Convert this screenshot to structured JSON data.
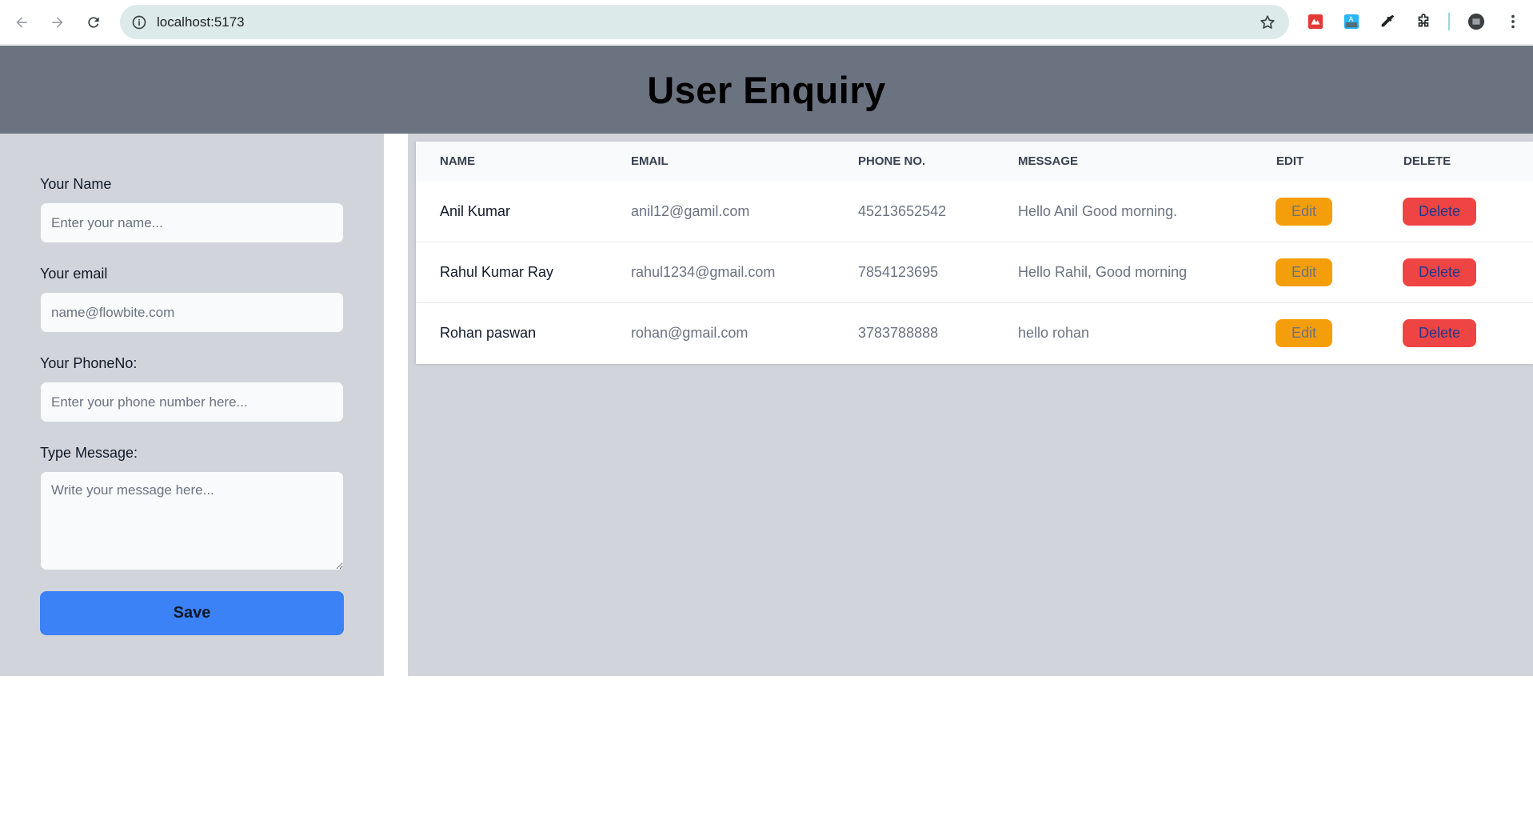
{
  "browser": {
    "url": "localhost:5173"
  },
  "header": {
    "title": "User Enquiry"
  },
  "form": {
    "name_label": "Your Name",
    "name_placeholder": "Enter your name...",
    "email_label": "Your email",
    "email_placeholder": "name@flowbite.com",
    "phone_label": "Your PhoneNo:",
    "phone_placeholder": "Enter your phone number here...",
    "message_label": "Type Message:",
    "message_placeholder": "Write your message here...",
    "save_label": "Save"
  },
  "table": {
    "columns": [
      "NAME",
      "EMAIL",
      "PHONE NO.",
      "MESSAGE",
      "EDIT",
      "DELETE"
    ],
    "rows": [
      {
        "name": "Anil Kumar",
        "email": "anil12@gamil.com",
        "phone": "45213652542",
        "message": "Hello Anil Good morning.",
        "edit": "Edit",
        "delete": "Delete"
      },
      {
        "name": "Rahul Kumar Ray",
        "email": "rahul1234@gmail.com",
        "phone": "7854123695",
        "message": "Hello Rahil, Good morning",
        "edit": "Edit",
        "delete": "Delete"
      },
      {
        "name": "Rohan paswan",
        "email": "rohan@gmail.com",
        "phone": "3783788888",
        "message": "hello rohan",
        "edit": "Edit",
        "delete": "Delete"
      }
    ]
  },
  "colors": {
    "header_bg": "#6b7280",
    "panel_bg": "#d1d5db",
    "save_bg": "#3b82f6",
    "edit_bg": "#f59e0b",
    "delete_bg": "#ef4444"
  }
}
